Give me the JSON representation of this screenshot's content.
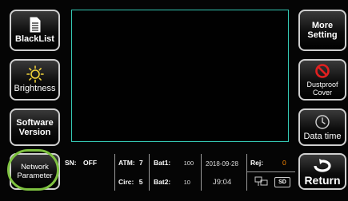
{
  "left_buttons": [
    {
      "name": "blacklist-button",
      "label": "BlackList",
      "icon": "document-icon"
    },
    {
      "name": "brightness-button",
      "label": "Brightness",
      "icon": "sun-icon"
    },
    {
      "name": "software-version-button",
      "label": "Software\nVersion"
    },
    {
      "name": "network-parameter-button",
      "label": "Network\nParameter"
    }
  ],
  "right_buttons": [
    {
      "name": "more-setting-button",
      "label": "More\nSetting"
    },
    {
      "name": "dustproof-cover-button",
      "label": "Dustproof\nCover",
      "icon": "no-entry-icon"
    },
    {
      "name": "data-time-button",
      "label": "Data time",
      "icon": "clock-icon"
    },
    {
      "name": "return-button",
      "label": "Return",
      "icon": "return-arrow-icon"
    }
  ],
  "status": {
    "sn_label": "SN:",
    "sn_value": "OFF",
    "atm_label": "ATM:",
    "atm_value": "7",
    "bat1_label": "Bat1:",
    "bat1_value": "100",
    "date": "2018-09-28",
    "rej_label": "Rej:",
    "rej_value": "0",
    "circ_label": "Circ:",
    "circ_value": "5",
    "bat2_label": "Bat2:",
    "bat2_value": "10",
    "time": "J9:04",
    "sd_label": "SD"
  },
  "colors": {
    "accent": "#35c9b4",
    "highlight": "#7fc241",
    "alert": "#e02020",
    "rej_value": "#ff8a00",
    "sun": "#f1d33a"
  }
}
